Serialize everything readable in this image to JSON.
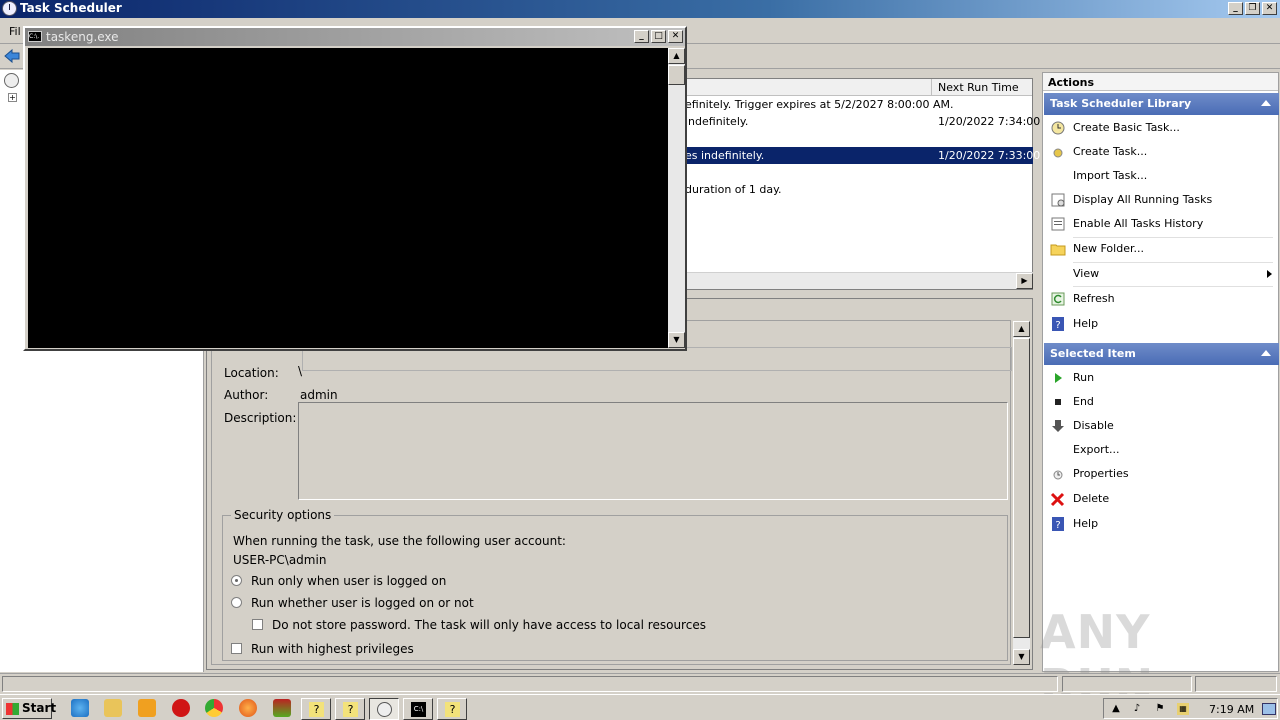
{
  "window": {
    "title": "Task Scheduler"
  },
  "menu": {
    "first_item": "Fil"
  },
  "tasklist": {
    "column_next_run": "Next Run Time",
    "rows": [
      {
        "trigger": "efinitely. Trigger expires at 5/2/2027 8:00:00 AM.",
        "next_run": ""
      },
      {
        "trigger": " indefinitely.",
        "next_run": "1/20/2022 7:34:00"
      },
      {
        "trigger": "es indefinitely.",
        "next_run": "1/20/2022 7:33:00"
      },
      {
        "trigger": "duration of 1 day.",
        "next_run": ""
      }
    ]
  },
  "detail": {
    "location_label": "Location:",
    "location_value": "\\",
    "author_label": "Author:",
    "author_value": "admin",
    "description_label": "Description:",
    "security_legend": "Security options",
    "user_account_prompt": "When running the task, use the following user account:",
    "user_account": "USER-PC\\admin",
    "opt_logged_on": "Run only when user is logged on",
    "opt_whether": "Run whether user is logged on or not",
    "opt_no_store": "Do not store password.  The task will only have access to local resources",
    "opt_highest": "Run with highest privileges"
  },
  "actions": {
    "header": "Actions",
    "library_section": "Task Scheduler Library",
    "library_items": [
      "Create Basic Task...",
      "Create Task...",
      "Import Task...",
      "Display All Running Tasks",
      "Enable All Tasks History",
      "New Folder...",
      "View",
      "Refresh",
      "Help"
    ],
    "selected_section": "Selected Item",
    "selected_items": [
      "Run",
      "End",
      "Disable",
      "Export...",
      "Properties",
      "Delete",
      "Help"
    ]
  },
  "console": {
    "title": "taskeng.exe",
    "icon_text": "C:\\."
  },
  "taskbar": {
    "start": "Start",
    "clock": "7:19 AM"
  },
  "watermark": "ANY RUN"
}
